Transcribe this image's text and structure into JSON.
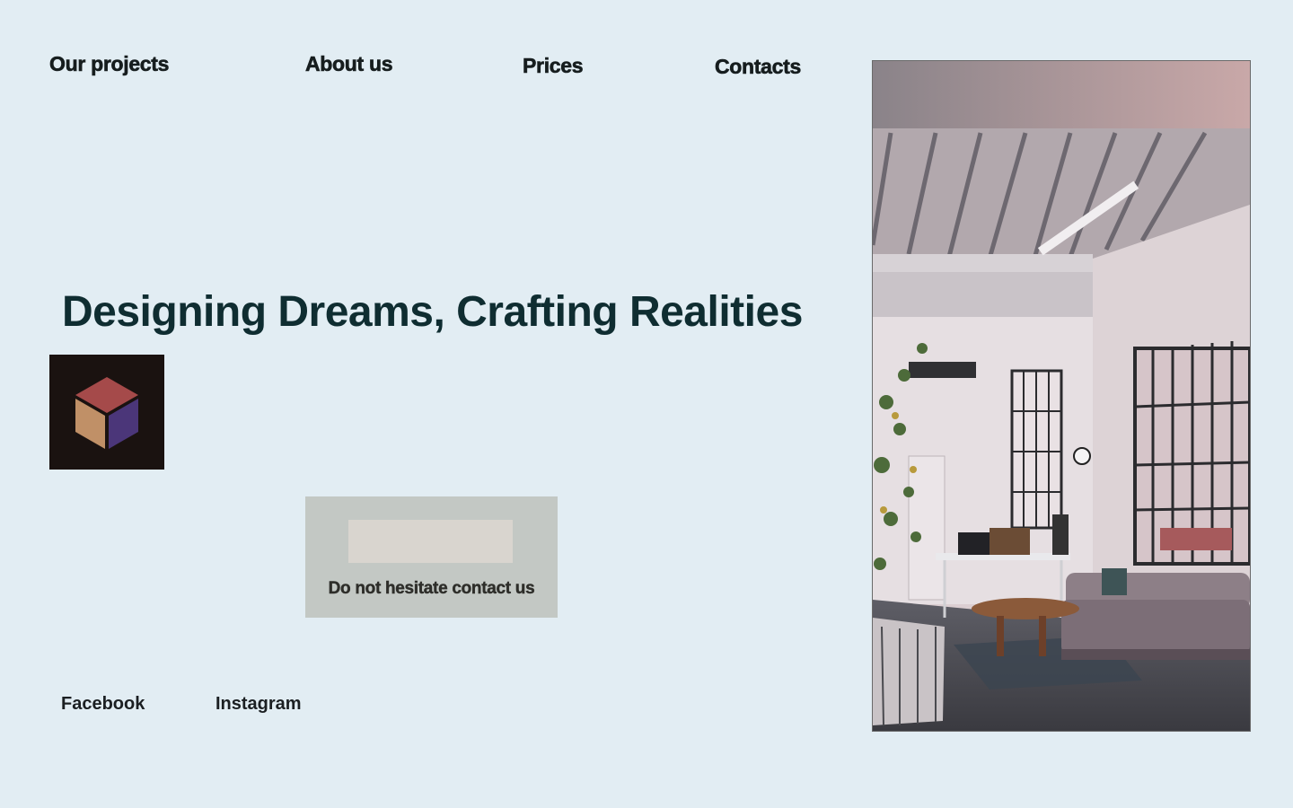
{
  "nav": {
    "items": [
      {
        "label": "Our projects"
      },
      {
        "label": "About us"
      },
      {
        "label": "Prices"
      },
      {
        "label": "Contacts"
      }
    ]
  },
  "hero": {
    "headline": "Designing Dreams, Crafting Realities"
  },
  "logo": {
    "icon": "cube-icon",
    "colors": {
      "top": "#a54a4a",
      "left": "#c09067",
      "right": "#4b3679",
      "background": "#1a1210"
    }
  },
  "cta": {
    "label": "Do not hesitate contact us"
  },
  "social": {
    "facebook": "Facebook",
    "instagram": "Instagram"
  },
  "photo": {
    "subject": "loft-office-interior-photo"
  },
  "theme": {
    "background": "#e2edf3",
    "headline_color": "#0f2d31",
    "cta_background": "#c3c8c4",
    "cta_field": "#d9d5cf"
  }
}
